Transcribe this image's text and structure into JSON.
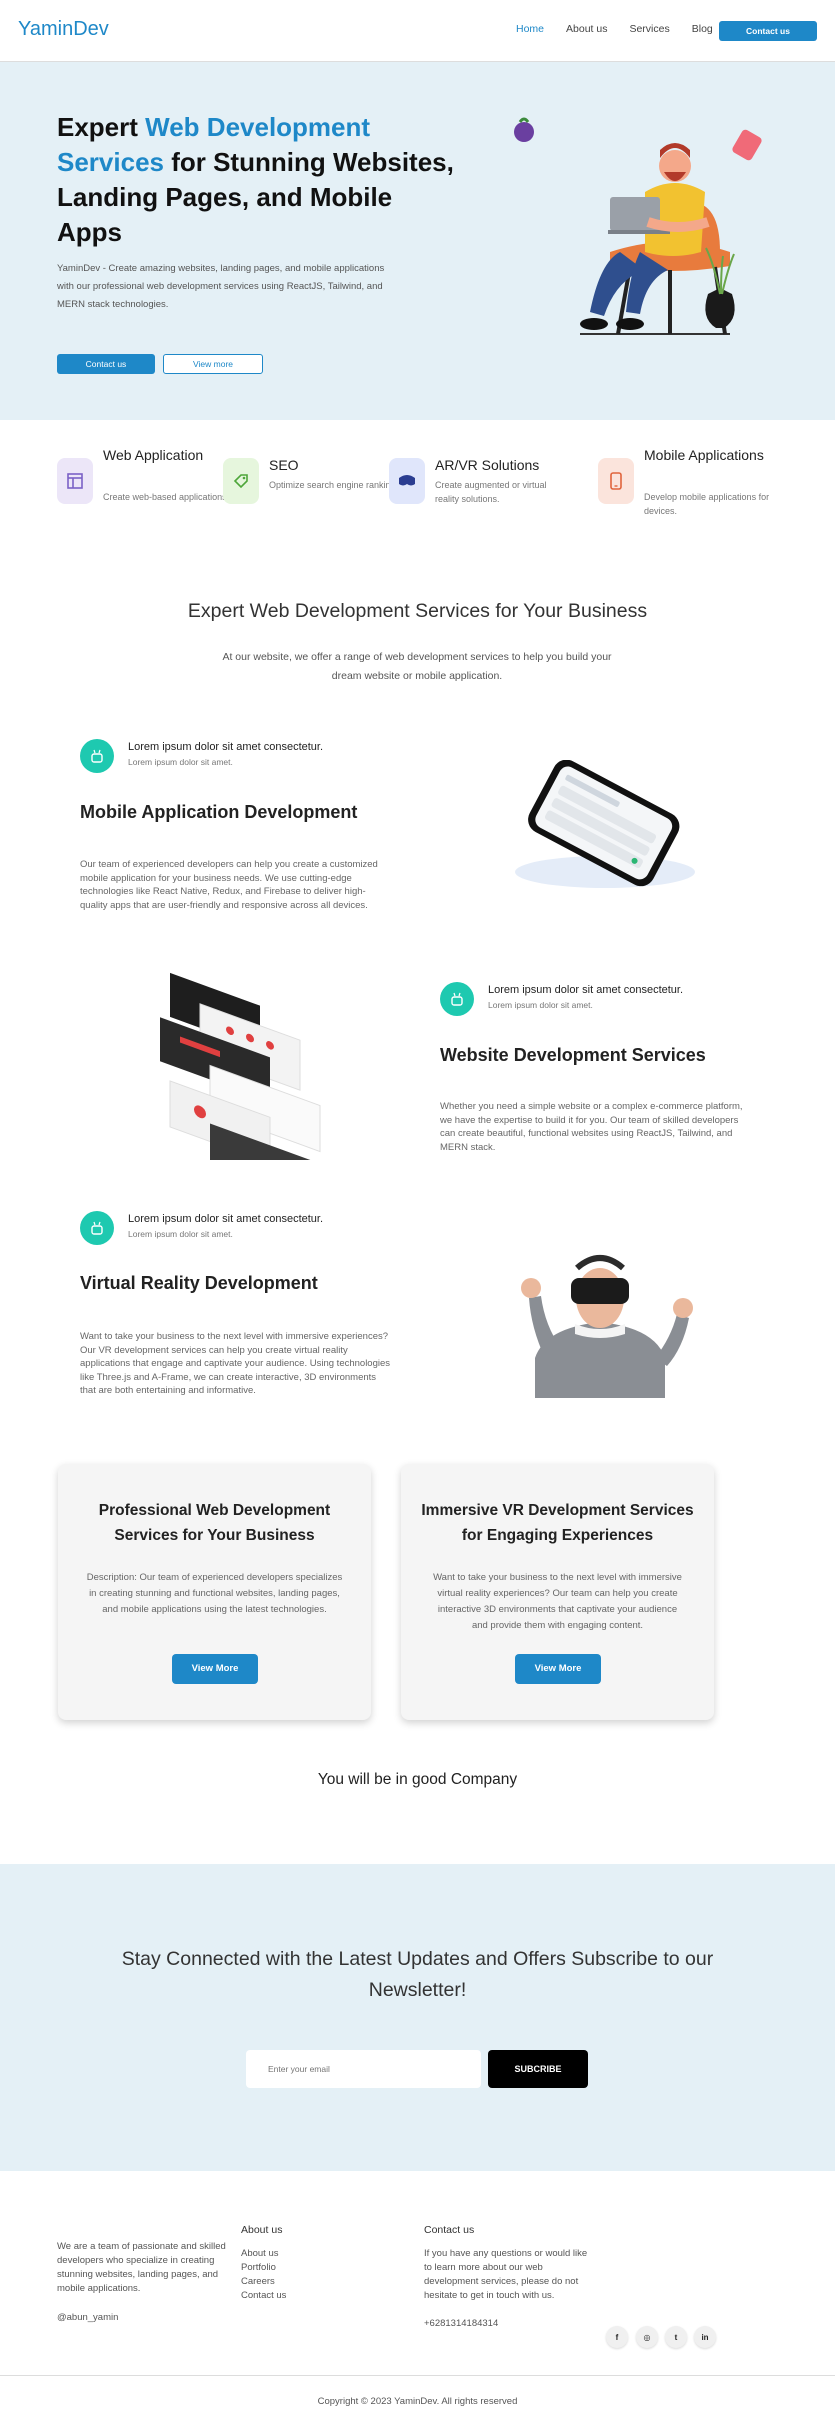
{
  "nav": {
    "logo": "YaminDev",
    "links": [
      "Home",
      "About us",
      "Services",
      "Blog"
    ],
    "cta": "Contact us",
    "accent": "#1e88c8"
  },
  "hero": {
    "title_a": "Expert ",
    "title_hl": "Web Development Services",
    "title_b": " for Stunning Websites, Landing Pages, and Mobile Apps",
    "desc": "YaminDev - Create amazing websites, landing pages, and mobile applications with our professional web development services using ReactJS, Tailwind, and MERN stack technologies.",
    "btn_primary": "Contact us",
    "btn_secondary": "View more"
  },
  "features": [
    {
      "title": "Web Application",
      "desc": "Create web-based applications.",
      "icon": "browser-window-icon",
      "color": "#ece6f8"
    },
    {
      "title": "SEO",
      "desc": "Optimize search engine ranking.",
      "icon": "tag-icon",
      "color": "#e6f6dd"
    },
    {
      "title": "AR/VR Solutions",
      "desc": "Create augmented or virtual reality solutions.",
      "icon": "vr-headset-icon",
      "color": "#e0e6fb"
    },
    {
      "title": "Mobile Applications",
      "desc": "Develop mobile applications for devices.",
      "icon": "smartphone-icon",
      "color": "#fbe4dc"
    }
  ],
  "services_intro": {
    "title": "Expert Web Development Services for Your Business",
    "subtitle": "At our website, we offer a range of web development services to help you build your dream website or mobile application."
  },
  "services": [
    {
      "kicker": "Lorem ipsum dolor sit amet consectetur.",
      "kicker2": "Lorem ipsum dolor sit amet.",
      "title": "Mobile Application Development",
      "desc": "Our team of experienced developers can help you create a customized mobile application for your business needs. We use cutting-edge technologies like React Native, Redux, and Firebase to deliver high-quality apps that are user-friendly and responsive across all devices."
    },
    {
      "kicker": "Lorem ipsum dolor sit amet consectetur.",
      "kicker2": "Lorem ipsum dolor sit amet.",
      "title": "Website Development Services",
      "desc": "Whether you need a simple website or a complex e-commerce platform, we have the expertise to build it for you. Our team of skilled developers can create beautiful, functional websites using ReactJS, Tailwind, and MERN stack."
    },
    {
      "kicker": "Lorem ipsum dolor sit amet consectetur.",
      "kicker2": "Lorem ipsum dolor sit amet.",
      "title": "Virtual Reality Development",
      "desc": "Want to take your business to the next level with immersive experiences? Our VR development services can help you create virtual reality applications that engage and captivate your audience. Using technologies like Three.js and A-Frame, we can create interactive, 3D environments that are both entertaining and informative."
    }
  ],
  "cards": [
    {
      "title": "Professional Web Development Services for Your Business",
      "desc": "Description: Our team of experienced developers specializes in creating stunning and functional websites, landing pages, and mobile applications using the latest technologies.",
      "btn": "View More"
    },
    {
      "title": "Immersive VR Development Services for Engaging Experiences",
      "desc": "Want to take your business to the next level with immersive virtual reality experiences? Our team can help you create interactive 3D environments that captivate your audience and provide them with engaging content.",
      "btn": "View More"
    }
  ],
  "company": "You will be in good Company",
  "newsletter": {
    "title": "Stay Connected with the Latest Updates and Offers Subscribe to our Newsletter!",
    "placeholder": "Enter your email",
    "btn": "SUBCRIBE"
  },
  "footer": {
    "about": "We are a team of passionate and skilled developers who specialize in creating stunning websites, landing pages, and mobile applications.",
    "handle": "@abun_yamin",
    "about_title": "About us",
    "links": [
      "About us",
      "Portfolio",
      "Careers",
      "Contact us"
    ],
    "contact_title": "Contact us",
    "contact_text": "If you have any questions or would like to learn more about our web development services, please do not hesitate to get in touch with us.",
    "phone": "+6281314184314",
    "social": [
      "f",
      "◎",
      "t",
      "in"
    ],
    "copyright": "Copyright © 2023 YaminDev. All rights reserved"
  }
}
